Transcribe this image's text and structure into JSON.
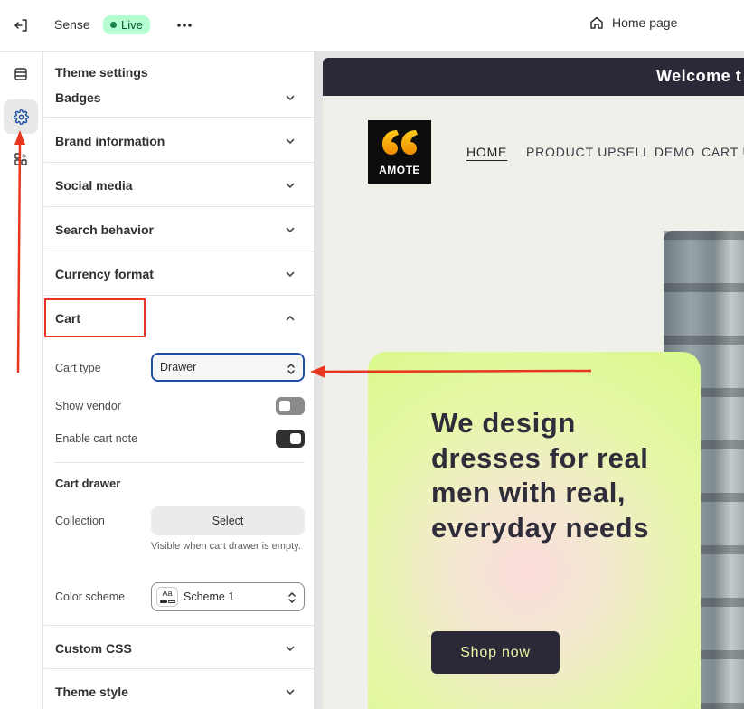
{
  "topbar": {
    "theme_name": "Sense",
    "status": "Live",
    "page_selector": "Home page"
  },
  "panel": {
    "title": "Theme settings",
    "sections_above": [
      {
        "label": "Badges"
      },
      {
        "label": "Brand information"
      },
      {
        "label": "Social media"
      },
      {
        "label": "Search behavior"
      },
      {
        "label": "Currency format"
      }
    ],
    "cart": {
      "label": "Cart",
      "cart_type_label": "Cart type",
      "cart_type_value": "Drawer",
      "show_vendor_label": "Show vendor",
      "show_vendor_on": false,
      "enable_note_label": "Enable cart note",
      "enable_note_on": true,
      "drawer_heading": "Cart drawer",
      "collection_label": "Collection",
      "collection_button": "Select",
      "collection_help": "Visible when cart drawer is empty.",
      "color_scheme_label": "Color scheme",
      "color_scheme_value": "Scheme 1",
      "swatch_text": "Aa"
    },
    "sections_below": [
      {
        "label": "Custom CSS"
      },
      {
        "label": "Theme style"
      }
    ]
  },
  "preview": {
    "announcement": "Welcome t",
    "logo_text": "AMOTE",
    "nav": [
      "HOME",
      "PRODUCT UPSELL DEMO",
      "CART U"
    ],
    "hero_title": "We design dresses for real men with real, everyday needs",
    "hero_button": "Shop now"
  },
  "colors": {
    "live_badge": "#b4fed2",
    "annotation": "#e8351f",
    "focus_ring": "#1d4fa3",
    "hero_button": "#2b2937",
    "hero_card": "#daf98a"
  }
}
